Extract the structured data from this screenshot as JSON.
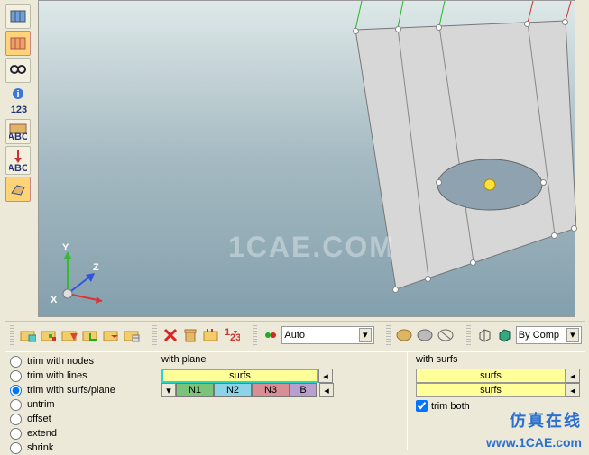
{
  "sidebar": {
    "items": [
      {
        "name": "display-blue"
      },
      {
        "name": "display-orange",
        "selected": true
      },
      {
        "name": "find-binoculars"
      },
      {
        "name": "info"
      },
      {
        "name": "numbers-123"
      },
      {
        "name": "grid-abc"
      },
      {
        "name": "arrow-abc"
      },
      {
        "name": "surface-tool"
      }
    ],
    "number_text": "123",
    "abc_text": "ABC"
  },
  "viewport": {
    "watermark": "1CAE.COM",
    "axis_x": "X",
    "axis_y": "Y",
    "axis_z": "Z"
  },
  "toolbar": {
    "auto_label": "Auto",
    "bycomp_label": "By Comp"
  },
  "panel": {
    "options": [
      {
        "label": "trim with nodes",
        "checked": false
      },
      {
        "label": "trim with lines",
        "checked": false
      },
      {
        "label": "trim with surfs/plane",
        "checked": true
      },
      {
        "label": "untrim",
        "checked": false
      },
      {
        "label": "offset",
        "checked": false
      },
      {
        "label": "extend",
        "checked": false
      },
      {
        "label": "shrink",
        "checked": false
      }
    ],
    "with_plane": {
      "header": "with plane",
      "surfs_label": "surfs",
      "nodes": [
        {
          "label": "N1",
          "bg": "#7ac47a"
        },
        {
          "label": "N2",
          "bg": "#5fb6d0"
        },
        {
          "label": "N3",
          "bg": "#cd7b84"
        },
        {
          "label": "B",
          "bg": "#a988c8"
        }
      ]
    },
    "with_surfs": {
      "header": "with surfs",
      "surfs_label": "surfs",
      "trim_both": "trim both"
    }
  },
  "footer": {
    "cn": "仿真在线",
    "url": "www.1CAE.com"
  }
}
